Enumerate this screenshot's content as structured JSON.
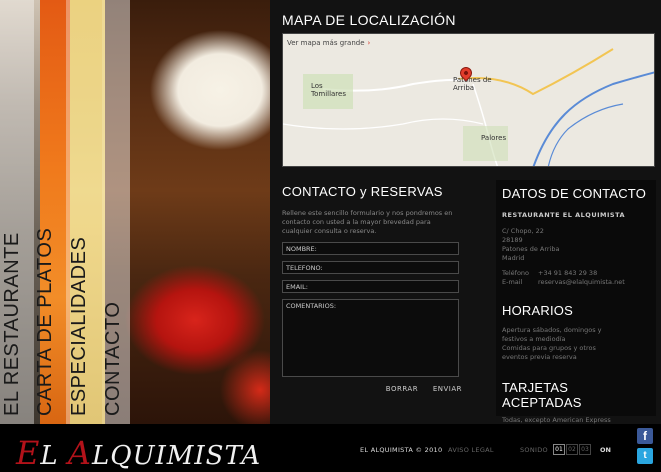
{
  "nav": {
    "items": [
      {
        "label": "EL RESTAURANTE"
      },
      {
        "label": "CARTA DE PLATOS"
      },
      {
        "label": "ESPECIALIDADES"
      },
      {
        "label": "CONTACTO"
      }
    ]
  },
  "map": {
    "title": "MAPA DE LOCALIZACIÓN",
    "link": "Ver mapa más grande",
    "places": [
      "Los Tomillares",
      "Patones de Arriba",
      "Palores"
    ]
  },
  "contact": {
    "title": "CONTACTO y RESERVAS",
    "intro": "Rellene este sencillo formulario y nos pondremos en contacto con usted a la mayor brevedad para cualquier consulta o reserva.",
    "fields": {
      "nombre": "NOMBRE:",
      "telefono": "TELEFONO:",
      "email": "EMAIL:",
      "comentarios": "COMENTARIOS:"
    },
    "borrar": "BORRAR",
    "enviar": "ENVIAR"
  },
  "datos": {
    "title": "DATOS DE CONTACTO",
    "name": "RESTAURANTE EL ALQUIMISTA",
    "address": [
      "C/ Chopo, 22",
      "28189",
      "Patones de Arriba",
      "Madrid"
    ],
    "telefono_label": "Teléfono",
    "telefono": "+34 91 843 29 38",
    "email_label": "E-mail",
    "email": "reservas@elalquimista.net"
  },
  "horarios": {
    "title": "HORARIOS",
    "lines": [
      "Apertura sábados, domingos y",
      "festivos a mediodía",
      "Comidas para grupos y otros",
      "eventos previa reserva"
    ]
  },
  "tarjetas": {
    "title": "TARJETAS ACEPTADAS",
    "text": "Todas, excepto American Express"
  },
  "footer": {
    "logo_rest": "L ",
    "logo_cap1": "E",
    "logo_cap2": "A",
    "logo_rest2": "LQUIMISTA",
    "copyright": "EL ALQUIMISTA © 2010",
    "aviso": "AVISO LEGAL",
    "sonido": "SONIDO",
    "vol": [
      "01",
      "02",
      "03"
    ],
    "on": "ON"
  },
  "colors": {
    "accent": "#b3121a",
    "facebook": "#3b5998",
    "twitter": "#2aa6e0"
  }
}
